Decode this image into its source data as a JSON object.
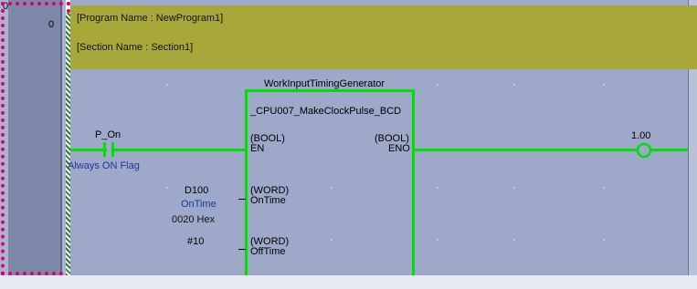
{
  "gutter": {
    "rung_start": "0",
    "rung_address": "0"
  },
  "comments": {
    "program": "[Program Name : NewProgram1]",
    "section": "[Section Name : Section1]"
  },
  "contact": {
    "name": "P_On",
    "comment": "Always ON Flag"
  },
  "function_block": {
    "instance": "WorkInputTimingGenerator",
    "type": "_CPU007_MakeClockPulse_BCD",
    "inputs": [
      {
        "datatype": "(BOOL)",
        "name": "EN",
        "operand": "",
        "operand_comment": "",
        "operand_value": ""
      },
      {
        "datatype": "(WORD)",
        "name": "OnTime",
        "operand": "D100",
        "operand_comment": "OnTime",
        "operand_value": "0020 Hex"
      },
      {
        "datatype": "(WORD)",
        "name": "OffTime",
        "operand": "#10",
        "operand_comment": "",
        "operand_value": ""
      }
    ],
    "outputs": [
      {
        "datatype": "(BOOL)",
        "name": "ENO"
      }
    ]
  },
  "coil": {
    "address": "1.00"
  },
  "colors": {
    "wire": "#00e000",
    "comment_band": "#a8a83a",
    "ladder_bg": "#9ea8c9",
    "selection": "#e0006c"
  }
}
